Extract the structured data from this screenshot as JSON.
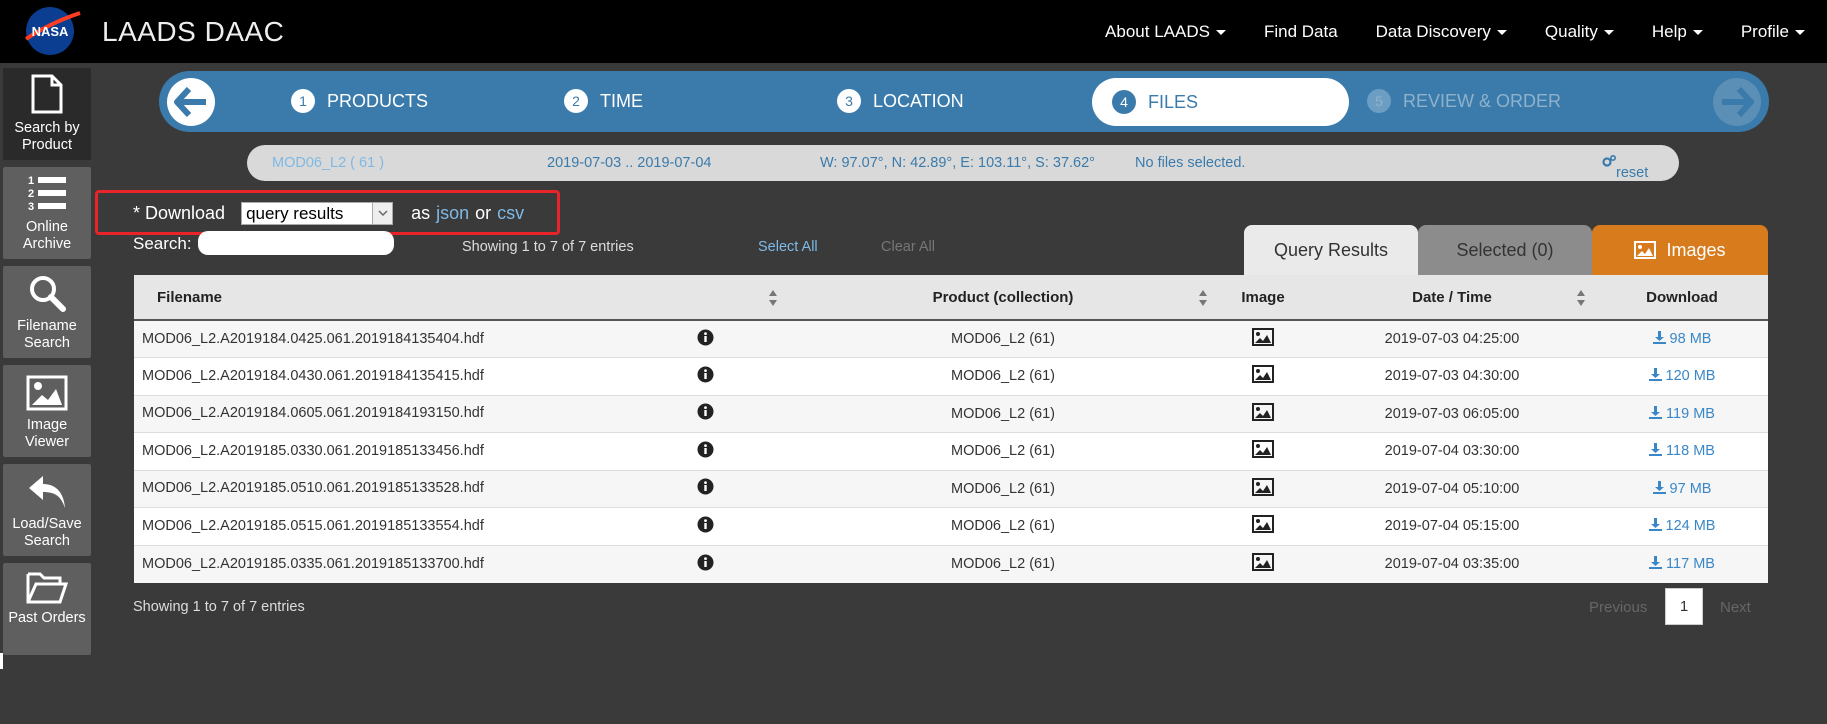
{
  "header": {
    "app_title": "LAADS DAAC",
    "logo_text": "NASA",
    "nav": [
      {
        "label": "About LAADS",
        "caret": true
      },
      {
        "label": "Find Data",
        "caret": false
      },
      {
        "label": "Data Discovery",
        "caret": true
      },
      {
        "label": "Quality",
        "caret": true
      },
      {
        "label": "Help",
        "caret": true
      },
      {
        "label": "Profile",
        "caret": true
      }
    ]
  },
  "sidebar": {
    "items": [
      {
        "label_1": "Search by",
        "label_2": "Product",
        "icon": "document-icon"
      },
      {
        "label_1": "Online",
        "label_2": "Archive",
        "icon": "numbered-list-icon"
      },
      {
        "label_1": "Filename",
        "label_2": "Search",
        "icon": "magnifier-icon"
      },
      {
        "label_1": "Image",
        "label_2": "Viewer",
        "icon": "picture-icon"
      },
      {
        "label_1": "Load/Save",
        "label_2": "Search",
        "icon": "reply-arrow-icon"
      },
      {
        "label_1": "Past Orders",
        "label_2": "",
        "icon": "folder-icon"
      }
    ]
  },
  "steps": {
    "items": [
      {
        "num": "1",
        "label": "PRODUCTS"
      },
      {
        "num": "2",
        "label": "TIME"
      },
      {
        "num": "3",
        "label": "LOCATION"
      },
      {
        "num": "4",
        "label": "FILES"
      },
      {
        "num": "5",
        "label": "REVIEW & ORDER"
      }
    ]
  },
  "summary": {
    "product": "MOD06_L2 ( 61 )",
    "dates": "2019-07-03 .. 2019-07-04",
    "location": "W: 97.07°, N: 42.89°, E: 103.11°, S: 37.62°",
    "files": "No files selected.",
    "reset": "reset"
  },
  "download": {
    "prefix": "* Download",
    "selected": "query results",
    "as": "as",
    "json": "json",
    "or": "or",
    "csv": "csv"
  },
  "search": {
    "label": "Search:",
    "value": "",
    "showing": "Showing 1 to 7 of 7 entries",
    "select_all": "Select All",
    "clear_all": "Clear All"
  },
  "tabs": {
    "query": "Query Results",
    "selected": "Selected (0)",
    "images": "Images"
  },
  "table": {
    "headers": {
      "filename": "Filename",
      "product": "Product (collection)",
      "image": "Image",
      "datetime": "Date / Time",
      "download": "Download"
    },
    "rows": [
      {
        "filename": "MOD06_L2.A2019184.0425.061.2019184135404.hdf",
        "product": "MOD06_L2 (61)",
        "datetime": "2019-07-03 04:25:00",
        "size": "98 MB"
      },
      {
        "filename": "MOD06_L2.A2019184.0430.061.2019184135415.hdf",
        "product": "MOD06_L2 (61)",
        "datetime": "2019-07-03 04:30:00",
        "size": "120 MB"
      },
      {
        "filename": "MOD06_L2.A2019184.0605.061.2019184193150.hdf",
        "product": "MOD06_L2 (61)",
        "datetime": "2019-07-03 06:05:00",
        "size": "119 MB"
      },
      {
        "filename": "MOD06_L2.A2019185.0330.061.2019185133456.hdf",
        "product": "MOD06_L2 (61)",
        "datetime": "2019-07-04 03:30:00",
        "size": "118 MB"
      },
      {
        "filename": "MOD06_L2.A2019185.0510.061.2019185133528.hdf",
        "product": "MOD06_L2 (61)",
        "datetime": "2019-07-04 05:10:00",
        "size": "97 MB"
      },
      {
        "filename": "MOD06_L2.A2019185.0515.061.2019185133554.hdf",
        "product": "MOD06_L2 (61)",
        "datetime": "2019-07-04 05:15:00",
        "size": "124 MB"
      },
      {
        "filename": "MOD06_L2.A2019185.0335.061.2019185133700.hdf",
        "product": "MOD06_L2 (61)",
        "datetime": "2019-07-04 03:35:00",
        "size": "117 MB"
      }
    ]
  },
  "footer": {
    "showing": "Showing 1 to 7 of 7 entries",
    "previous": "Previous",
    "page": "1",
    "next": "Next"
  },
  "colors": {
    "step_bar": "#3a7bab",
    "images_tab": "#d87b1d",
    "highlight_box": "#e8242a",
    "link": "#7fb9e6"
  }
}
